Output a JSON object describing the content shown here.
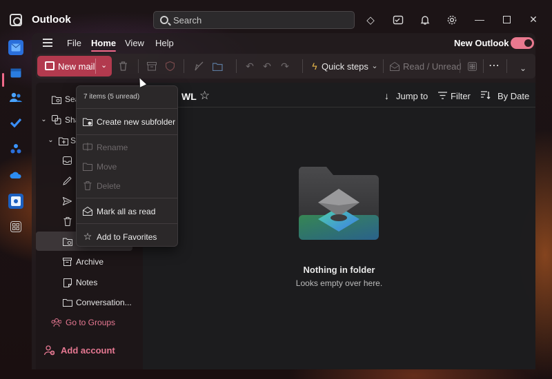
{
  "app": {
    "title": "Outlook"
  },
  "search": {
    "placeholder": "Search"
  },
  "titlebar_icons": [
    "premium-diamond-icon",
    "my-day-icon",
    "notifications-bell-icon",
    "settings-gear-icon"
  ],
  "window_controls": [
    "minimize",
    "maximize",
    "close"
  ],
  "rail": {
    "items": [
      "mail-icon",
      "calendar-icon",
      "people-icon",
      "todo-check-icon",
      "groups-icon",
      "onedrive-cloud-icon",
      "organization-icon",
      "apps-grid-icon"
    ],
    "active": "mail-icon"
  },
  "menu": {
    "tabs": [
      "File",
      "Home",
      "View",
      "Help"
    ],
    "active_tab": "Home",
    "new_outlook_label": "New Outlook",
    "new_outlook_enabled": true
  },
  "ribbon": {
    "new_mail_label": "New mail",
    "quick_steps_label": "Quick steps",
    "read_unread_label": "Read / Unread"
  },
  "folder_pane": {
    "items": [
      {
        "label": "Sea",
        "icon": "search-folder-icon"
      },
      {
        "label": "Sha",
        "icon": "shared-icon"
      },
      {
        "label": "Se",
        "icon": "folder-icon"
      },
      {
        "label": "",
        "icon": "inbox-icon"
      },
      {
        "label": "",
        "icon": "drafts-pencil-icon"
      },
      {
        "label": "",
        "icon": "sent-icon"
      },
      {
        "label": "",
        "icon": "deleted-trash-icon"
      },
      {
        "label": "",
        "icon": "wl-folder-icon"
      },
      {
        "label": "Archive",
        "icon": "archive-icon"
      },
      {
        "label": "Notes",
        "icon": "notes-icon"
      },
      {
        "label": "Conversation...",
        "icon": "conversation-folder-icon"
      }
    ],
    "go_to_groups": "Go to Groups",
    "add_account": "Add account"
  },
  "message_list": {
    "folder_name": "WL",
    "jump_to_label": "Jump to",
    "filter_label": "Filter",
    "sort_label": "By Date",
    "empty_title": "Nothing in folder",
    "empty_subtitle": "Looks empty over here."
  },
  "context_menu": {
    "header": "7 items (5 unread)",
    "items": [
      {
        "label": "Create new subfolder",
        "icon": "new-folder-icon",
        "enabled": true
      },
      {
        "label": "Rename",
        "icon": "rename-icon",
        "enabled": false
      },
      {
        "label": "Move",
        "icon": "move-folder-icon",
        "enabled": false
      },
      {
        "label": "Delete",
        "icon": "delete-icon",
        "enabled": false
      },
      {
        "label": "Mark all as read",
        "icon": "mark-read-icon",
        "enabled": true
      },
      {
        "label": "Add to Favorites",
        "icon": "star-icon",
        "enabled": true
      }
    ]
  },
  "colors": {
    "accent": "#f06a8a",
    "new_mail_button": "#b23a4e",
    "panel_bg": "#1c1c1e"
  }
}
